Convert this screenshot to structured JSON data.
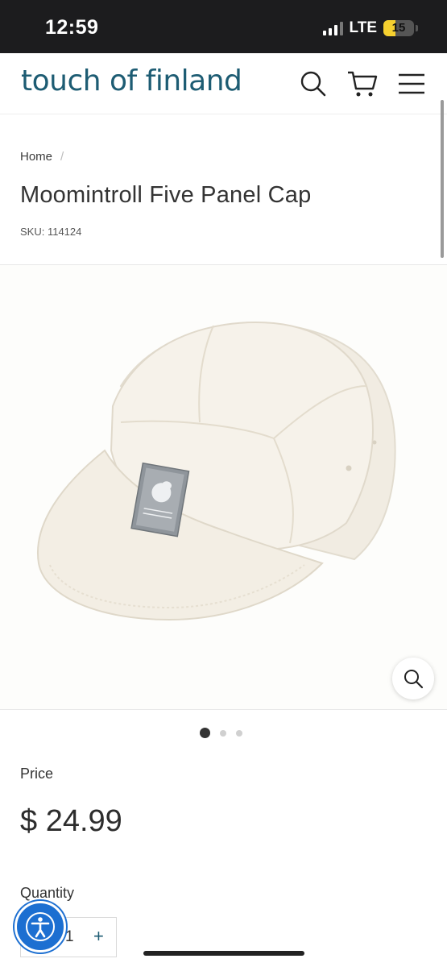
{
  "status_bar": {
    "time": "12:59",
    "network": "LTE",
    "battery": "15",
    "battery_color": "#f5d02f"
  },
  "header": {
    "logo": "touch of finland",
    "brand_color": "#1d5c73",
    "icons": [
      "search-icon",
      "cart-icon",
      "menu-icon"
    ]
  },
  "breadcrumb": {
    "home": "Home",
    "separator": "/"
  },
  "product": {
    "title": "Moomintroll Five Panel Cap",
    "sku": "SKU: 114124",
    "image_alt_icons": [
      "zoom-icon"
    ],
    "carousel": {
      "total": 3,
      "active": 1
    }
  },
  "price": {
    "label": "Price",
    "value": "$ 24.99"
  },
  "quantity": {
    "label": "Quantity",
    "value": "1",
    "plus": "+"
  },
  "accessibility": {
    "icon": "accessibility-icon",
    "color": "#1c6fd1"
  }
}
